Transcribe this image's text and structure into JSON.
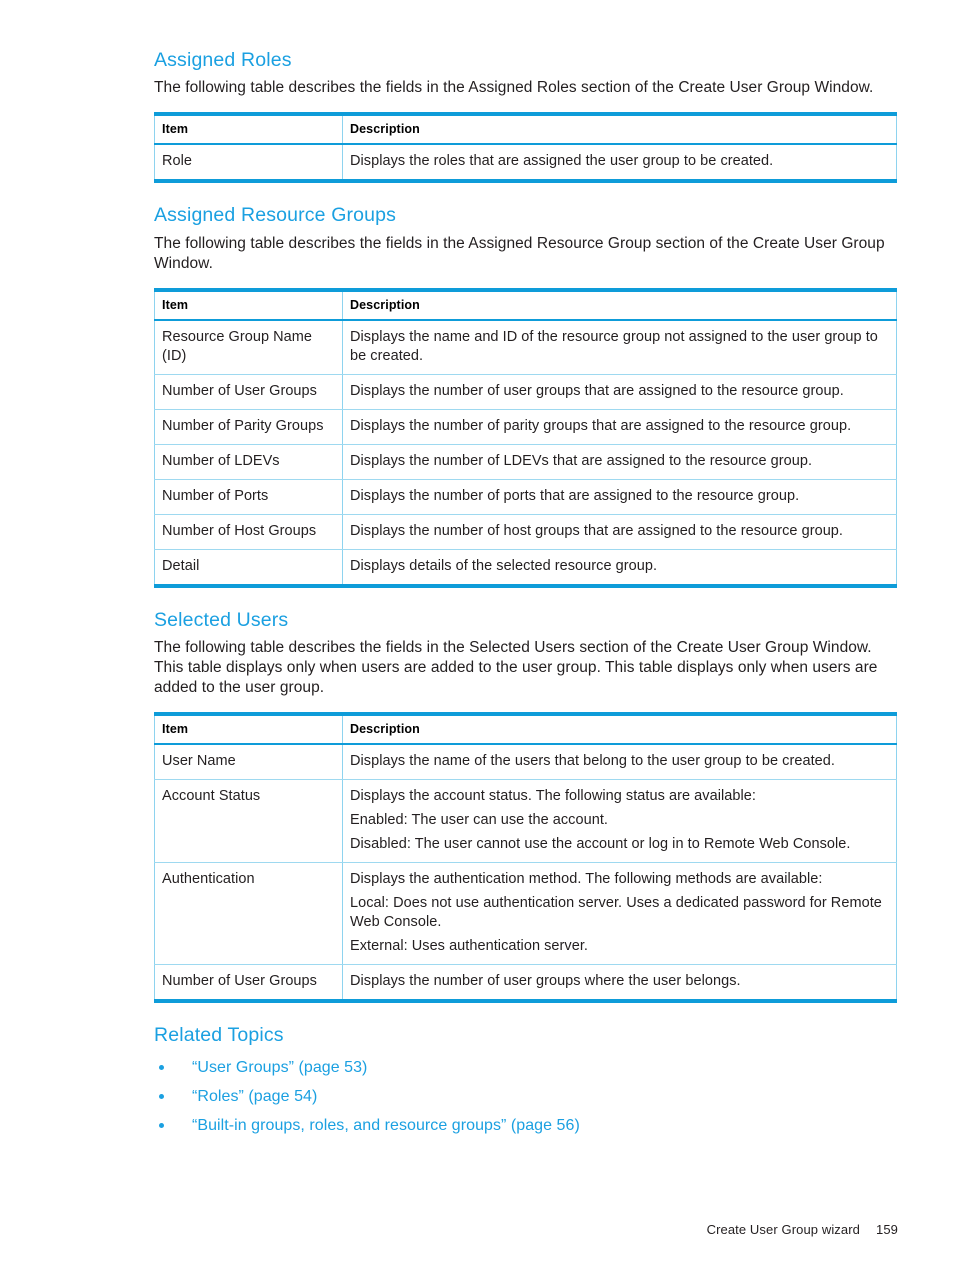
{
  "page": {
    "footer_title": "Create User Group wizard",
    "footer_page_number": "159",
    "heading_color": "#1ba0e1",
    "table_border_color": "#0e9cd9",
    "table_inner_border_color": "#9ed9f0"
  },
  "sections": [
    {
      "heading": "Assigned Roles",
      "intro": "The following table describes the fields in the Assigned Roles section of the Create User Group Window.",
      "table": {
        "columns": [
          "Item",
          "Description"
        ],
        "rows": [
          {
            "item": "Role",
            "description_lines": [
              "Displays the roles that are assigned the user group to be created."
            ]
          }
        ]
      }
    },
    {
      "heading": "Assigned Resource Groups",
      "intro": "The following table describes the fields in the Assigned Resource Group section of the Create User Group Window.",
      "table": {
        "columns": [
          "Item",
          "Description"
        ],
        "rows": [
          {
            "item": "Resource Group Name (ID)",
            "description_lines": [
              "Displays the name and ID of the resource group not assigned to the user group to be created."
            ]
          },
          {
            "item": "Number of User Groups",
            "description_lines": [
              "Displays the number of user groups that are assigned to the resource group."
            ]
          },
          {
            "item": "Number of Parity Groups",
            "description_lines": [
              "Displays the number of parity groups that are assigned to the resource group."
            ]
          },
          {
            "item": "Number of LDEVs",
            "description_lines": [
              "Displays the number of LDEVs that are assigned to the resource group."
            ]
          },
          {
            "item": "Number of Ports",
            "description_lines": [
              "Displays the number of ports that are assigned to the resource group."
            ]
          },
          {
            "item": "Number of Host Groups",
            "description_lines": [
              "Displays the number of host groups that are assigned to the resource group."
            ]
          },
          {
            "item": "Detail",
            "description_lines": [
              "Displays details of the selected resource group."
            ]
          }
        ]
      }
    },
    {
      "heading": "Selected Users",
      "intro": "The following table describes the fields in the Selected Users section of the Create User Group Window. This table displays only when users are added to the user group. This table displays only when users are added to the user group.",
      "table": {
        "columns": [
          "Item",
          "Description"
        ],
        "rows": [
          {
            "item": "User Name",
            "description_lines": [
              "Displays the name of the users that belong to the user group to be created."
            ]
          },
          {
            "item": "Account Status",
            "description_lines": [
              "Displays the account status. The following status are available:",
              "Enabled: The user can use the account.",
              "Disabled: The user cannot use the account or log in to Remote Web Console."
            ]
          },
          {
            "item": "Authentication",
            "description_lines": [
              "Displays the authentication method. The following methods are available:",
              "Local: Does not use authentication server. Uses a dedicated password for Remote Web Console.",
              "External: Uses authentication server."
            ]
          },
          {
            "item": "Number of User Groups",
            "description_lines": [
              "Displays the number of user groups where the user belongs."
            ]
          }
        ]
      }
    }
  ],
  "related_topics": {
    "heading": "Related Topics",
    "items": [
      "“User Groups” (page 53)",
      "“Roles” (page 54)",
      "“Built-in groups, roles, and resource groups” (page 56)"
    ]
  }
}
